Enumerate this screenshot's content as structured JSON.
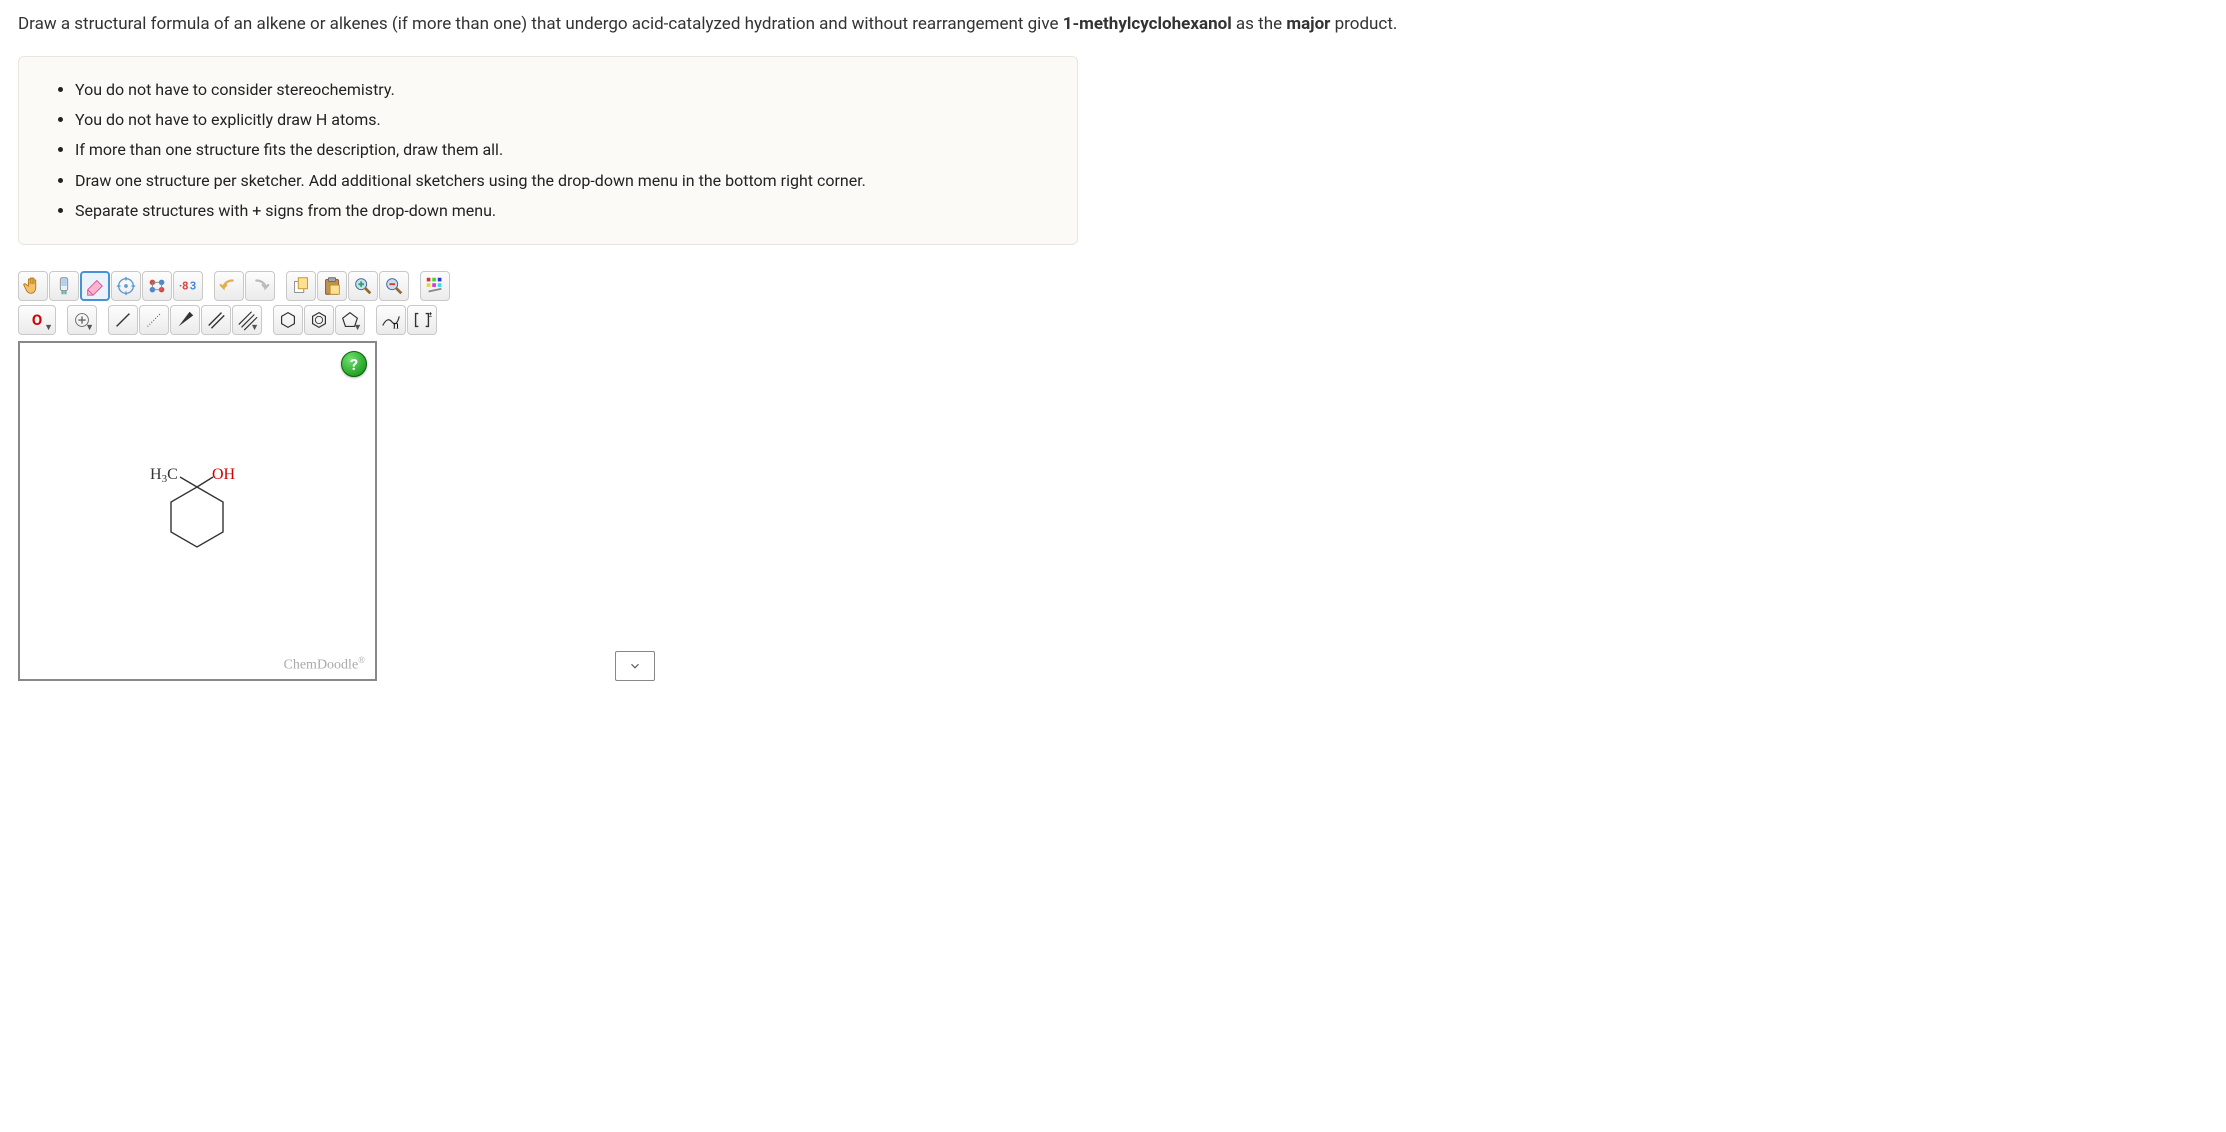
{
  "question": {
    "prefix": "Draw a structural formula of an alkene or alkenes (if more than one) that undergo acid-catalyzed hydration and without rearrangement give ",
    "bold1": "1-methylcyclohexanol",
    "mid": " as the ",
    "bold2": "major",
    "suffix": " product."
  },
  "instructions": [
    "You do not have to consider stereochemistry.",
    "You do not have to explicitly draw H atoms.",
    "If more than one structure fits the description, draw them all.",
    "Draw one structure per sketcher. Add additional sketchers using the drop-down menu in the bottom right corner.",
    "Separate structures with + signs from the drop-down menu."
  ],
  "toolbar": {
    "atom_label": "O",
    "help": "?"
  },
  "molecule": {
    "label_left": "H₃C",
    "label_right": "OH"
  },
  "branding": "ChemDoodle"
}
